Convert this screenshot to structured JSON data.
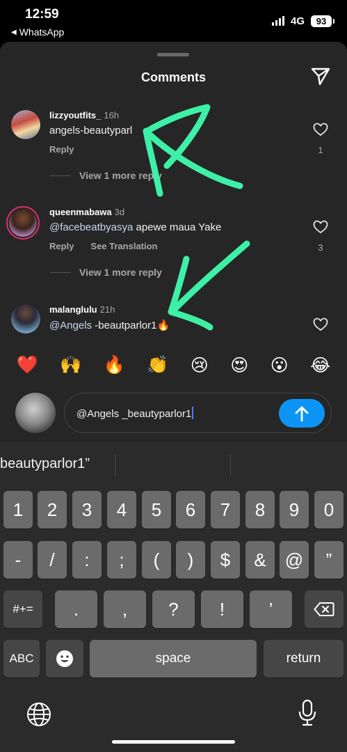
{
  "status": {
    "time": "12:59",
    "back_app": "WhatsApp",
    "network": "4G",
    "battery": "93"
  },
  "sheet": {
    "title": "Comments"
  },
  "comments": [
    {
      "user": "lizzyoutfits_",
      "ago": "16h",
      "text": "angels-beautyparl",
      "reply": "Reply",
      "likes": "1",
      "view_more": "View 1 more reply"
    },
    {
      "user": "queenmabawa",
      "ago": "3d",
      "mention": "@facebeatbyasya",
      "text": " apewe maua Yake",
      "reply": "Reply",
      "translate": "See Translation",
      "likes": "3",
      "view_more": "View 1 more reply"
    },
    {
      "user": "malanglulu",
      "ago": "21h",
      "mention": "@Angels",
      "text": " -beautparlor1🔥"
    }
  ],
  "emojis": [
    "❤️",
    "🙌",
    "🔥",
    "👏",
    "😢",
    "😍",
    "😮",
    "😂"
  ],
  "input": {
    "value": "@Angels _beautyparlor1"
  },
  "keyboard": {
    "suggestion": "beautyparlor1”",
    "row1": [
      "1",
      "2",
      "3",
      "4",
      "5",
      "6",
      "7",
      "8",
      "9",
      "0"
    ],
    "row2": [
      "-",
      "/",
      ":",
      ";",
      "(",
      ")",
      "$",
      "&",
      "@",
      "”"
    ],
    "row3": [
      ".",
      ",",
      "?",
      "!",
      "’"
    ],
    "symbols_key": "#+=",
    "abc_key": "ABC",
    "space_key": "space",
    "return_key": "return"
  },
  "colors": {
    "sheet_bg": "#262626",
    "post_button": "#0d95f6",
    "annotation_arrow": "#3ef0a6"
  }
}
